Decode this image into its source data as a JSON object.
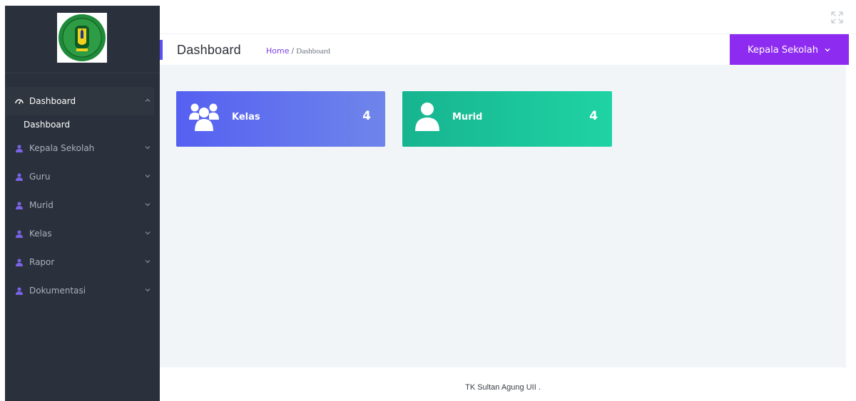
{
  "colors": {
    "sidebar_bg": "#2b313c",
    "accent_purple": "#8e2bf0",
    "card_kelas": "#5560f1",
    "card_murid": "#17b48f",
    "content_bg": "#f1f5f8"
  },
  "sidebar": {
    "logo_icon": "school-crest-logo",
    "menu": {
      "dashboard": {
        "label": "Dashboard",
        "icon": "dashboard-icon",
        "expanded": true,
        "sub": "Dashboard"
      },
      "kepala_sekolah": {
        "label": "Kepala Sekolah",
        "icon": "user-icon"
      },
      "guru": {
        "label": "Guru",
        "icon": "user-icon"
      },
      "murid": {
        "label": "Murid",
        "icon": "user-icon"
      },
      "kelas": {
        "label": "Kelas",
        "icon": "user-icon"
      },
      "rapor": {
        "label": "Rapor",
        "icon": "user-icon"
      },
      "dokumentasi": {
        "label": "Dokumentasi",
        "icon": "user-icon"
      }
    }
  },
  "topbar": {
    "fullscreen_icon": "expand-icon"
  },
  "header": {
    "title": "Dashboard",
    "breadcrumb": {
      "home": "Home",
      "separator": "/",
      "current": "Dashboard"
    },
    "user_button": "Kepala Sekolah"
  },
  "cards": {
    "kelas": {
      "label": "Kelas",
      "value": "4",
      "icon": "users-group-icon"
    },
    "murid": {
      "label": "Murid",
      "value": "4",
      "icon": "user-icon"
    }
  },
  "footer": {
    "text": "TK Sultan Agung UII ."
  }
}
